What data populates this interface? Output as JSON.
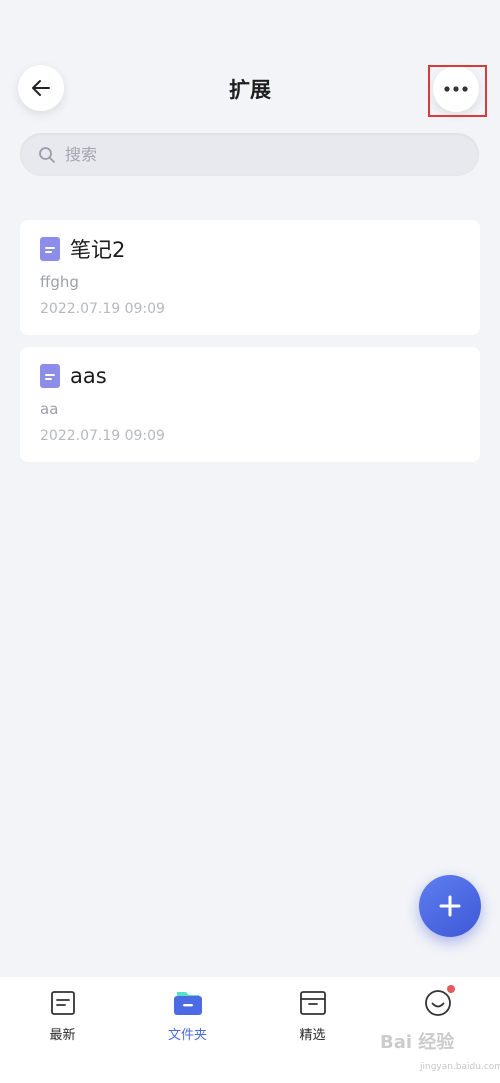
{
  "header": {
    "title": "扩展",
    "back_icon": "arrow-left-icon",
    "more_icon": "more-horizontal-icon"
  },
  "search": {
    "placeholder": "搜索",
    "icon": "search-icon"
  },
  "notes": [
    {
      "title": "笔记2",
      "preview": "ffghg",
      "date": "2022.07.19 09:09",
      "icon": "document-icon"
    },
    {
      "title": "aas",
      "preview": "aa",
      "date": "2022.07.19 09:09",
      "icon": "document-icon"
    }
  ],
  "fab": {
    "icon": "plus-icon"
  },
  "tabs": [
    {
      "label": "最新",
      "icon": "note-icon",
      "active": false
    },
    {
      "label": "文件夹",
      "icon": "folder-icon",
      "active": true
    },
    {
      "label": "精选",
      "icon": "archive-box-icon",
      "active": false
    },
    {
      "label": "",
      "icon": "smiley-icon",
      "active": false,
      "badge": true
    }
  ],
  "watermark": {
    "text": "Bai 经验",
    "sub": "jingyan.baidu.com"
  },
  "colors": {
    "background": "#f3f4f8",
    "accent": "#4b6be4",
    "doc_icon": "#8b8de8",
    "highlight": "#d93a3a",
    "badge": "#e25c5c"
  }
}
